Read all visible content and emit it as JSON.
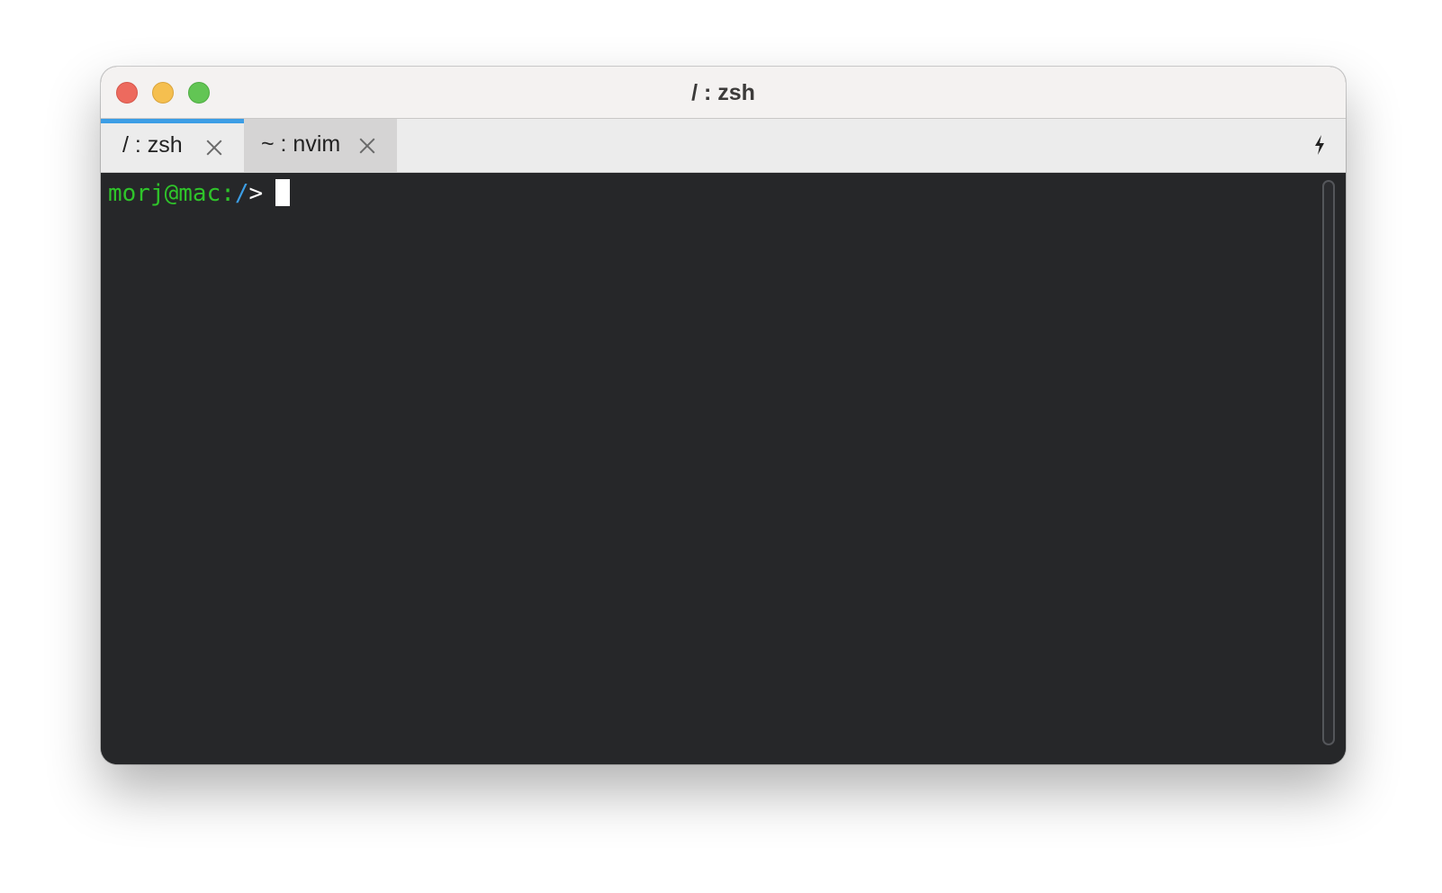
{
  "window": {
    "title": "/ : zsh"
  },
  "tabs": [
    {
      "label": "/ : zsh",
      "active": true
    },
    {
      "label": "~ : nvim",
      "active": false
    }
  ],
  "toolbar": {
    "action_icon": "bolt-icon"
  },
  "terminal": {
    "prompt_user_host": "morj@mac:",
    "prompt_path": "/",
    "prompt_symbol": ">",
    "input": ""
  },
  "colors": {
    "prompt_user": "#2fc42a",
    "prompt_path": "#3c9ee6",
    "terminal_bg": "#262729",
    "active_tab_accent": "#3c9ee6"
  }
}
